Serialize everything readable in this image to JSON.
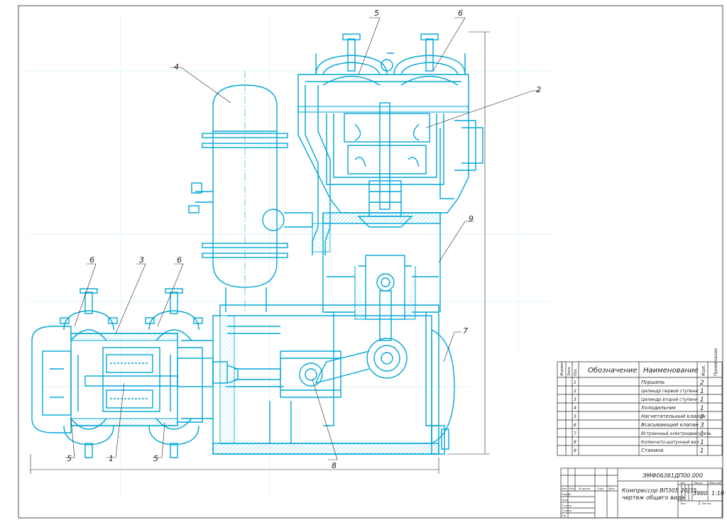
{
  "callouts": {
    "c1": "1",
    "c2": "2",
    "c3": "3",
    "c4": "4",
    "c5a": "5",
    "c5b": "5",
    "c5c": "5",
    "c6a": "6",
    "c6b": "6",
    "c6c": "6",
    "c7": "7",
    "c8": "8",
    "c9": "9"
  },
  "spec_table": {
    "headers": {
      "format": "Формат",
      "zone": "Зона",
      "pos": "Поз.",
      "designation": "Обозначение",
      "name": "Наименование",
      "qty": "Кол.",
      "note": "Примечание"
    },
    "rows": [
      {
        "pos": "1",
        "name": "Поршень",
        "qty": "2"
      },
      {
        "pos": "2",
        "name": "Цилиндр первой ступени",
        "qty": "1"
      },
      {
        "pos": "3",
        "name": "Цилиндр второй ступени",
        "qty": "1"
      },
      {
        "pos": "4",
        "name": "Холодильник",
        "qty": "1"
      },
      {
        "pos": "5",
        "name": "Нагнетательный клапан",
        "qty": "3"
      },
      {
        "pos": "6",
        "name": "Всасывающий клапан",
        "qty": "3"
      },
      {
        "pos": "7",
        "name": "Встроенный электродвигатель",
        "qty": "1"
      },
      {
        "pos": "8",
        "name": "Коленчато-шатунный вал",
        "qty": "1"
      },
      {
        "pos": "9",
        "name": "Станина",
        "qty": "1"
      }
    ]
  },
  "title_block": {
    "doc_code": "ЭМФ06381ДП00.000",
    "title_line1": "Компрессор ВП305 20/35",
    "title_line2": "чертеж общего вида",
    "lit_label": "Лит",
    "mass_label": "Масса",
    "scale_label": "Масштаб",
    "mass": "3980",
    "scale": "1:10",
    "sheet_label": "Лист",
    "sheets_label": "Листов",
    "izm": "Изм",
    "list": "Лист",
    "ndoc": "№ докум",
    "sign": "Подп",
    "date": "Дата",
    "razrab": "Разраб",
    "prov": "Пров",
    "tkontr": "Т.контр",
    "nkontr": "Н.контр",
    "utv": "Утв"
  },
  "colors": {
    "line": "#00a6d6",
    "black": "#222222",
    "hatch": "#33bde8"
  }
}
